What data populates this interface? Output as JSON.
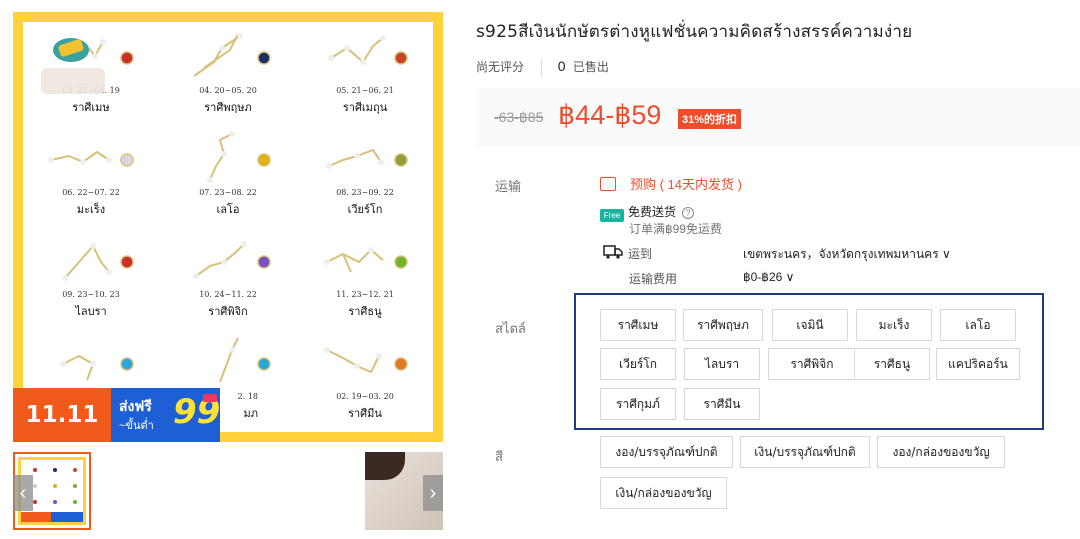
{
  "gallery": {
    "zodiac": [
      {
        "date": "03. 21~04. 19",
        "name": "ราศีเมษ",
        "gem": "#c8312a"
      },
      {
        "date": "04. 20~05. 20",
        "name": "ราศีพฤษภ",
        "gem": "#1d2e66"
      },
      {
        "date": "05. 21~06. 21",
        "name": "ราศีเมถุน",
        "gem": "#c8452a"
      },
      {
        "date": "06. 22~07. 22",
        "name": "มะเร็ง",
        "gem": "#d8d8e0"
      },
      {
        "date": "07. 23~08. 22",
        "name": "เลโอ",
        "gem": "#e1b31a"
      },
      {
        "date": "08. 23~09. 22",
        "name": "เวียร์โก",
        "gem": "#8fa233"
      },
      {
        "date": "09. 23~10. 23",
        "name": "ไลบรา",
        "gem": "#c8312a"
      },
      {
        "date": "10. 24~11. 22",
        "name": "ราศีพิจิก",
        "gem": "#7a4fc0"
      },
      {
        "date": "11. 23~12. 21",
        "name": "ราศีธนู",
        "gem": "#6fb52c"
      },
      {
        "date": "",
        "name": "",
        "gem": "#2aa7d8"
      },
      {
        "date": "2. 18",
        "name": "มภ",
        "gem": "#2aa7d8"
      },
      {
        "date": "02. 19~03. 20",
        "name": "ราศีมีน",
        "gem": "#e07a22"
      }
    ],
    "promo": {
      "left": "11.11",
      "ship": "ส่งฟรี",
      "min": "~ขั้นต่ำ",
      "num": "99"
    },
    "prev_icon": "chevron-left-icon",
    "next_icon": "chevron-right-icon",
    "prev_glyph": "‹",
    "next_glyph": "›"
  },
  "product": {
    "title": "s925สีเงินนักษัตรต่างหูแฟชั่นความคิดสร้างสรรค์ความง่าย",
    "rating": "尚无评分",
    "sold_count": "0",
    "sold_label": "已售出",
    "old_price": "-63-฿85",
    "price": "฿44-฿59",
    "discount": "31%的折扣"
  },
  "shipping": {
    "label": "运输",
    "preorder": "预购 ( 14天内发货 )",
    "free_badge": "Free",
    "free_label": "免费送货",
    "free_condition": "订单满฿99免运费",
    "ship_to_label": "运到",
    "ship_to_value": "เขตพระนคร，จังหวัดกรุงเทพมหานคร ∨",
    "fee_label": "运输费用",
    "fee_value": "฿0-฿26 ∨",
    "info_glyph": "?"
  },
  "variants": {
    "style_label": "สไตล์",
    "styles": [
      "ราศีเมษ",
      "ราศีพฤษภ",
      "เจมินี",
      "มะเร็ง",
      "เลโอ",
      "เวียร์โก",
      "ไลบรา",
      "ราศีพิจิก",
      "ราศีธนู",
      "แคปริคอร์น",
      "ราศีกุมภ์",
      "ราศีมีน"
    ],
    "color_label": "สี",
    "colors": [
      "งอง/บรรจุภัณฑ์ปกติ",
      "เงิน/บรรจุภัณฑ์ปกติ",
      "งอง/กล่องของขวัญ",
      "เงิน/กล่องของขวัญ"
    ]
  },
  "colors": {
    "accent": "#ee4d2d",
    "frame": "#ffd23d",
    "panel_border": "#1e3d7a"
  }
}
